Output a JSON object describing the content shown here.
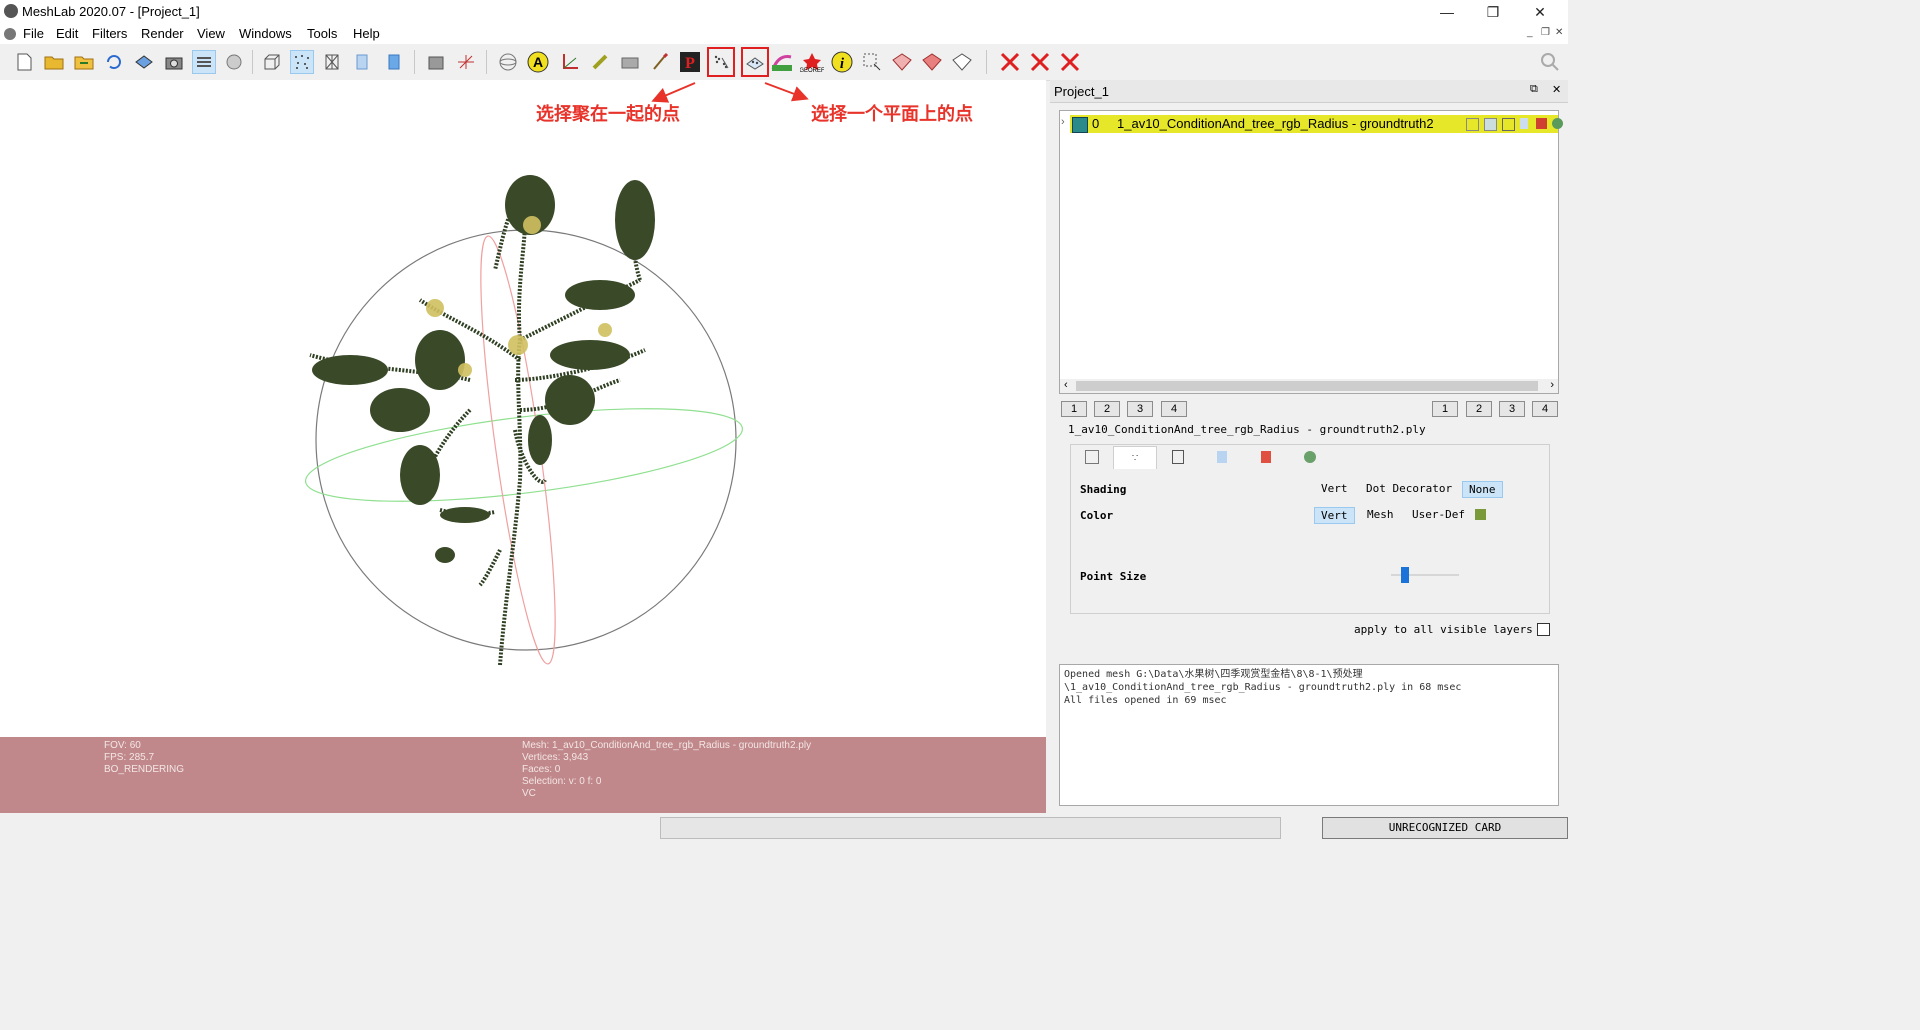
{
  "window": {
    "title": "MeshLab 2020.07 - [Project_1]",
    "minimize": "—",
    "restore": "❐",
    "close": "✕",
    "mdi_minimize": "_",
    "mdi_restore": "❐",
    "mdi_close": "✕"
  },
  "menu": [
    "File",
    "Edit",
    "Filters",
    "Render",
    "View",
    "Windows",
    "Tools",
    "Help"
  ],
  "toolbar": {
    "search_icon": "search-icon"
  },
  "annotations": {
    "left": "选择聚在一起的点",
    "right": "选择一个平面上的点"
  },
  "info": {
    "fov": "FOV: 60",
    "fps": "FPS:  285.7",
    "rendering": "BO_RENDERING",
    "mesh": "Mesh: 1_av10_ConditionAnd_tree_rgb_Radius - groundtruth2.ply",
    "vertices": "Vertices: 3,943",
    "faces": "Faces: 0",
    "selection": "Selection: v: 0 f: 0",
    "vc": "VC"
  },
  "panel": {
    "title": "Project_1",
    "float_icon": "⧉",
    "close_icon": "✕",
    "layer": {
      "index": "0",
      "name": "1_av10_ConditionAnd_tree_rgb_Radius - groundtruth2"
    },
    "left_buttons": [
      "1",
      "2",
      "3",
      "4"
    ],
    "right_buttons": [
      "1",
      "2",
      "3",
      "4"
    ],
    "mesh_file": "1_av10_ConditionAnd_tree_rgb_Radius - groundtruth2.ply"
  },
  "decorator": {
    "shading_label": "Shading",
    "shading_options": [
      "Vert",
      "Dot Decorator",
      "None"
    ],
    "shading_selected": "None",
    "color_label": "Color",
    "color_options": [
      "Vert",
      "Mesh",
      "User-Def"
    ],
    "color_selected": "Vert",
    "user_color": "#7a9a3a",
    "point_size_label": "Point Size",
    "point_size_fraction": 0.2,
    "apply_all": "apply to all visible layers"
  },
  "log": [
    "Opened mesh G:\\Data\\水果树\\四季观赏型金桔\\8\\8-1\\预处理",
    "\\1_av10_ConditionAnd_tree_rgb_Radius - groundtruth2.ply in 68 msec",
    "All files opened in 69 msec"
  ],
  "status": {
    "card": "UNRECOGNIZED CARD"
  },
  "colors": {
    "info_bar": "#c0888a",
    "layer_highlight": "#e7e72a",
    "annotation": "#e8332a"
  }
}
